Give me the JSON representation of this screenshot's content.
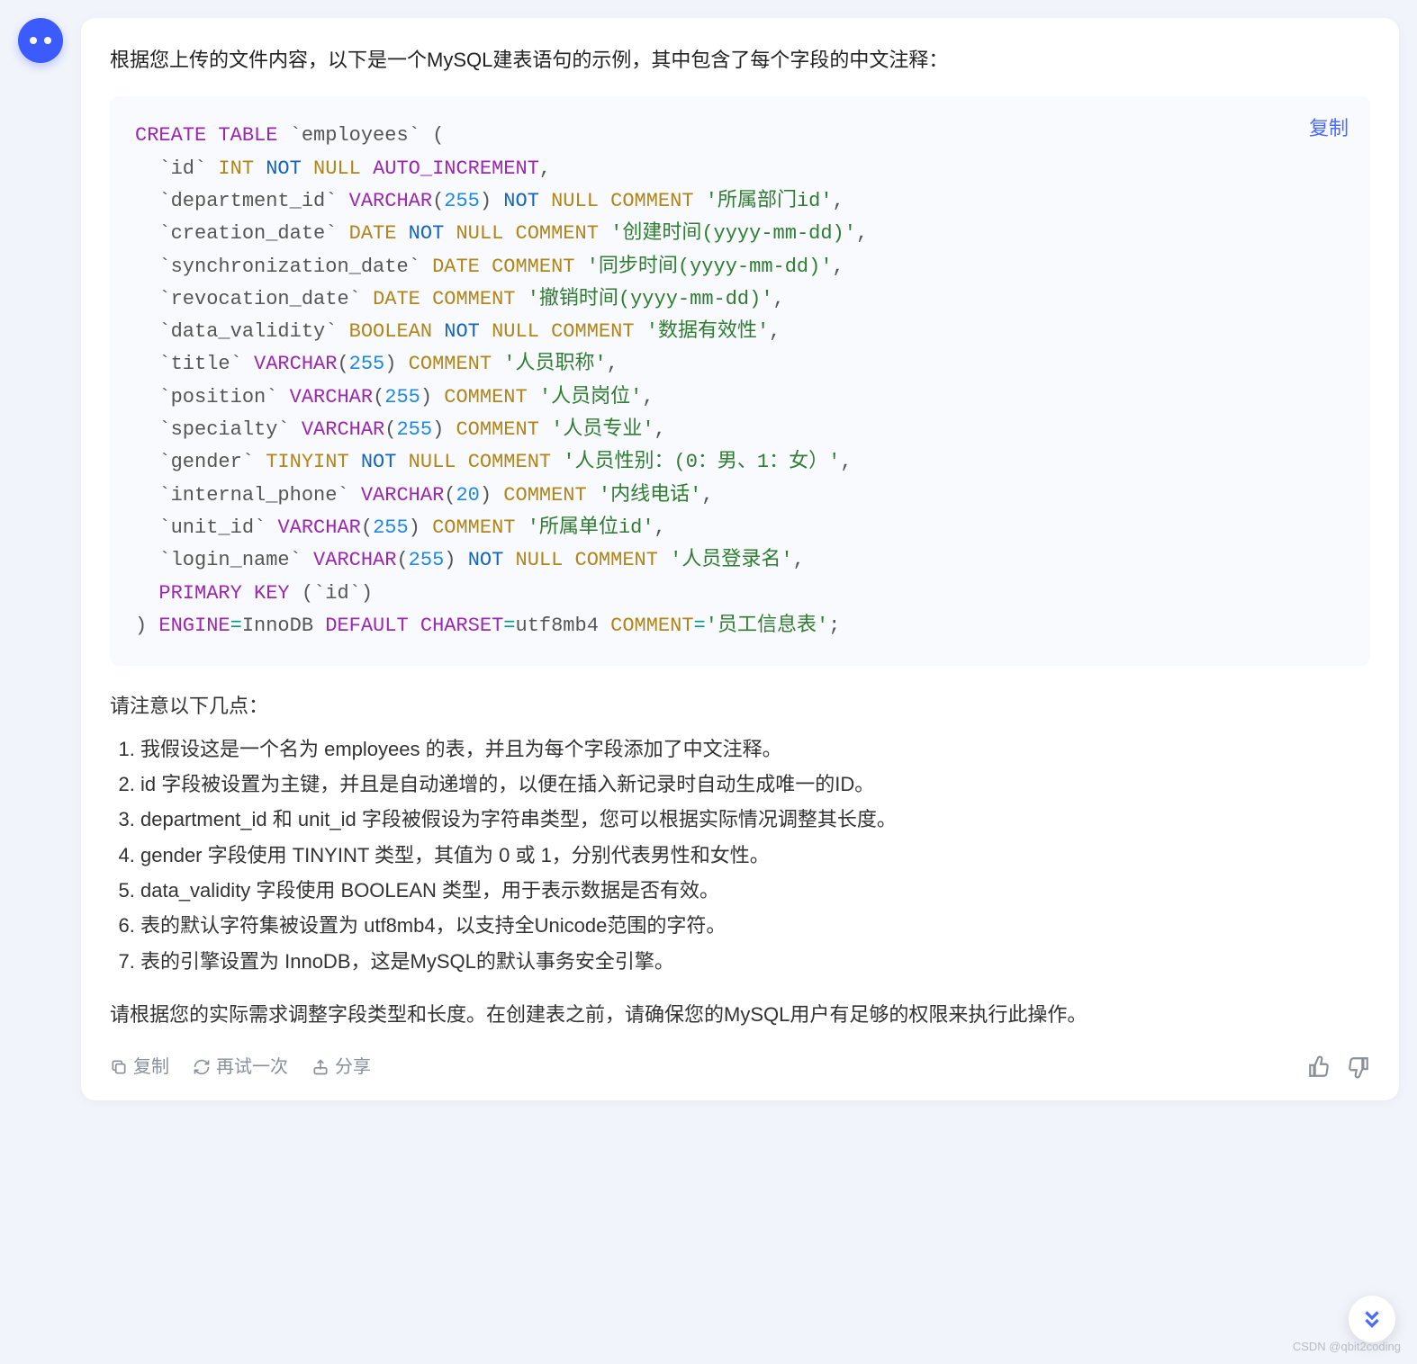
{
  "message": {
    "intro": "根据您上传的文件内容，以下是一个MySQL建表语句的示例，其中包含了每个字段的中文注释：",
    "notes_title": "请注意以下几点：",
    "notes": [
      "我假设这是一个名为 employees 的表，并且为每个字段添加了中文注释。",
      "id 字段被设置为主键，并且是自动递增的，以便在插入新记录时自动生成唯一的ID。",
      "department_id 和 unit_id 字段被假设为字符串类型，您可以根据实际情况调整其长度。",
      "gender 字段使用 TINYINT 类型，其值为 0 或 1，分别代表男性和女性。",
      "data_validity 字段使用 BOOLEAN 类型，用于表示数据是否有效。",
      "表的默认字符集被设置为 utf8mb4，以支持全Unicode范围的字符。",
      "表的引擎设置为 InnoDB，这是MySQL的默认事务安全引擎。"
    ],
    "footer": "请根据您的实际需求调整字段类型和长度。在创建表之前，请确保您的MySQL用户有足够的权限来执行此操作。"
  },
  "code": {
    "copy_label": "复制",
    "table_name": "employees",
    "engine": "InnoDB",
    "charset": "utf8mb4",
    "table_comment": "员工信息表",
    "tokens": {
      "create": "CREATE",
      "table": "TABLE",
      "int": "INT",
      "not": "NOT",
      "null": "NULL",
      "auto_increment": "AUTO_INCREMENT",
      "varchar": "VARCHAR",
      "date": "DATE",
      "boolean": "BOOLEAN",
      "tinyint": "TINYINT",
      "comment": "COMMENT",
      "primary": "PRIMARY",
      "key": "KEY",
      "engine_kw": "ENGINE",
      "default": "DEFAULT",
      "charset_kw": "CHARSET",
      "n255": "255",
      "n20": "20"
    },
    "columns": {
      "id": "id",
      "department_id": "department_id",
      "creation_date": "creation_date",
      "synchronization_date": "synchronization_date",
      "revocation_date": "revocation_date",
      "data_validity": "data_validity",
      "title": "title",
      "position": "position",
      "specialty": "specialty",
      "gender": "gender",
      "internal_phone": "internal_phone",
      "unit_id": "unit_id",
      "login_name": "login_name"
    },
    "comments": {
      "department_id": "所属部门id",
      "creation_date": "创建时间(yyyy-mm-dd)",
      "synchronization_date": "同步时间(yyyy-mm-dd)",
      "revocation_date": "撤销时间(yyyy-mm-dd)",
      "data_validity": "数据有效性",
      "title": "人员职称",
      "position": "人员岗位",
      "specialty": "人员专业",
      "gender": "人员性别：(0：男、1：女）",
      "internal_phone": "内线电话",
      "unit_id": "所属单位id",
      "login_name": "人员登录名"
    }
  },
  "actions": {
    "copy": "复制",
    "retry": "再试一次",
    "share": "分享"
  },
  "watermark": "CSDN @qbit2coding"
}
